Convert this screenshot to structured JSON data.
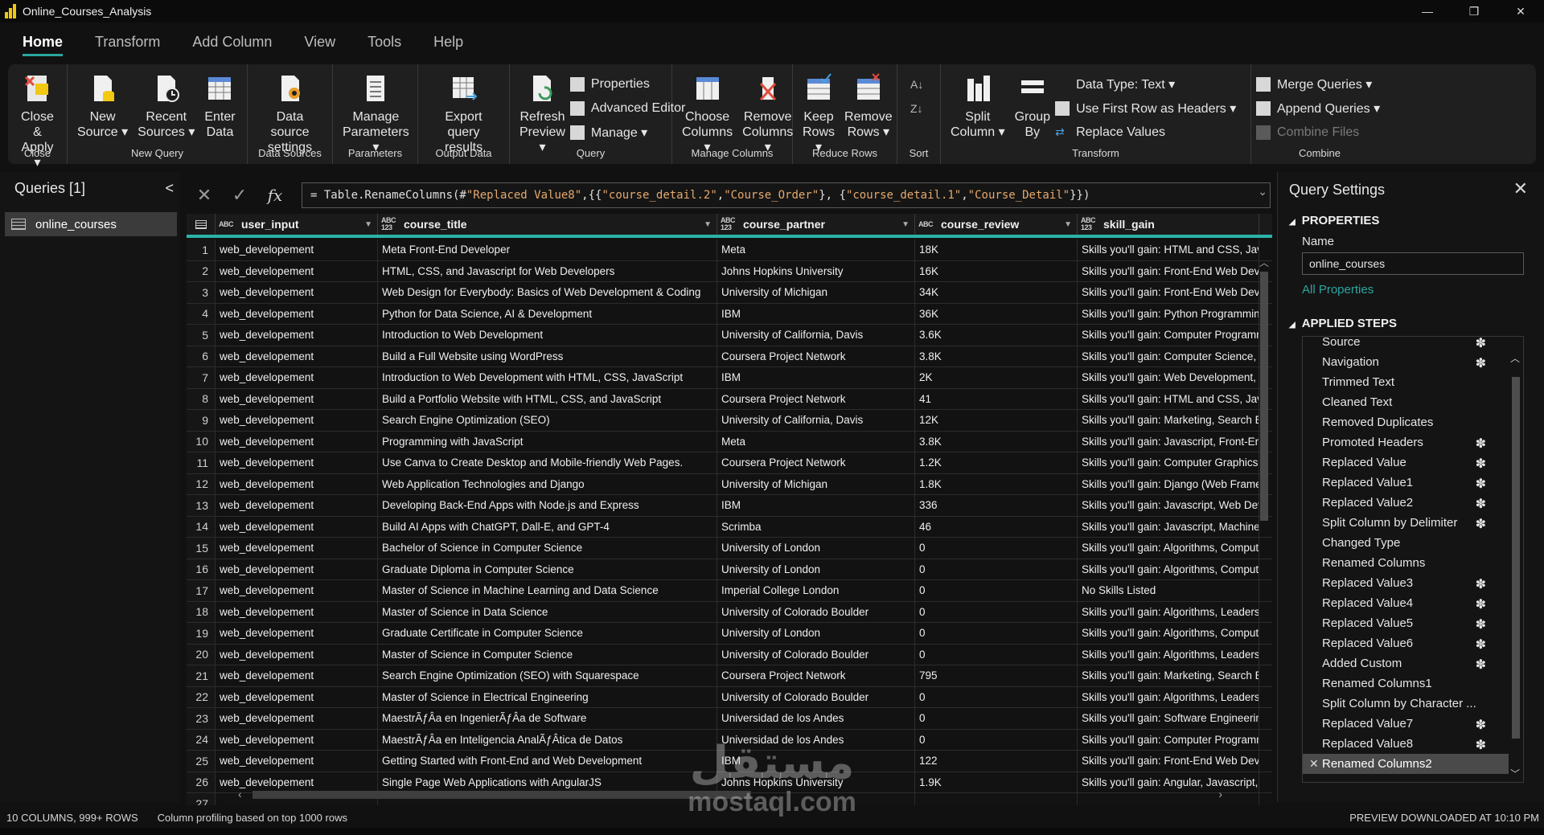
{
  "window": {
    "title": "Online_Courses_Analysis",
    "controls": [
      "—",
      "❐",
      "✕"
    ]
  },
  "menu": {
    "tabs": [
      "Home",
      "Transform",
      "Add Column",
      "View",
      "Tools",
      "Help"
    ],
    "active": "Home"
  },
  "ribbon": {
    "groups": {
      "close": {
        "label": "Close",
        "close_apply": "Close &\nApply ▾"
      },
      "new_query": {
        "label": "New Query",
        "new_source": "New\nSource ▾",
        "recent_sources": "Recent\nSources ▾",
        "enter_data": "Enter\nData"
      },
      "data_sources": {
        "label": "Data Sources",
        "settings": "Data source\nsettings"
      },
      "parameters": {
        "label": "Parameters",
        "manage": "Manage\nParameters ▾"
      },
      "output_data": {
        "label": "Output Data",
        "export": "Export query\nresults"
      },
      "query": {
        "label": "Query",
        "refresh": "Refresh\nPreview ▾",
        "properties": "Properties",
        "advanced_editor": "Advanced Editor",
        "manage": "Manage ▾"
      },
      "manage_columns": {
        "label": "Manage Columns",
        "choose": "Choose\nColumns ▾",
        "remove": "Remove\nColumns ▾"
      },
      "reduce_rows": {
        "label": "Reduce Rows",
        "keep": "Keep\nRows ▾",
        "remove": "Remove\nRows ▾"
      },
      "sort": {
        "label": "Sort"
      },
      "transform": {
        "label": "Transform",
        "split": "Split\nColumn ▾",
        "group": "Group\nBy",
        "data_type": "Data Type: Text ▾",
        "first_row": "Use First Row as Headers ▾",
        "replace": "Replace Values"
      },
      "combine": {
        "label": "Combine",
        "merge": "Merge Queries ▾",
        "append": "Append Queries ▾",
        "combine_files": "Combine Files"
      }
    }
  },
  "queries": {
    "title": "Queries [1]",
    "collapse": "<",
    "items": [
      "online_courses"
    ]
  },
  "formula": {
    "prefix": "= Table.RenameColumns(#",
    "s1": "\"Replaced Value8\"",
    "mid1": ",{{",
    "s2": "\"course_detail.2\"",
    "mid2": ", ",
    "s3": "\"Course_Order\"",
    "mid3": "}, {",
    "s4": "\"course_detail.1\"",
    "mid4": ", ",
    "s5": "\"Course_Detail\"",
    "suffix": "}})"
  },
  "grid": {
    "columns": [
      {
        "type": "ABC",
        "name": "user_input"
      },
      {
        "type": "ABC\n123",
        "name": "course_title"
      },
      {
        "type": "ABC\n123",
        "name": "course_partner"
      },
      {
        "type": "ABC",
        "name": "course_review"
      },
      {
        "type": "ABC\n123",
        "name": "skill_gain"
      }
    ],
    "rows": [
      [
        "1",
        "web_developement",
        "Meta Front-End Developer",
        "Meta",
        "18K",
        "Skills you'll gain: HTML and CSS, Javas"
      ],
      [
        "2",
        "web_developement",
        "HTML, CSS, and Javascript for Web Developers",
        "Johns Hopkins University",
        "16K",
        "Skills you'll gain: Front-End Web Deve"
      ],
      [
        "3",
        "web_developement",
        "Web Design for Everybody: Basics of Web Development & Coding",
        "University of Michigan",
        "34K",
        "Skills you'll gain: Front-End Web Deve"
      ],
      [
        "4",
        "web_developement",
        "Python for Data Science, AI & Development",
        "IBM",
        "36K",
        "Skills you'll gain: Python Programming"
      ],
      [
        "5",
        "web_developement",
        "Introduction to Web Development",
        "University of California, Davis",
        "3.6K",
        "Skills you'll gain: Computer Programm"
      ],
      [
        "6",
        "web_developement",
        "Build a Full Website using WordPress",
        "Coursera Project Network",
        "3.8K",
        "Skills you'll gain: Computer Science, Co"
      ],
      [
        "7",
        "web_developement",
        "Introduction to Web Development with HTML, CSS, JavaScript",
        "IBM",
        "2K",
        "Skills you'll gain: Web Development, Ja"
      ],
      [
        "8",
        "web_developement",
        "Build a Portfolio Website with HTML, CSS, and JavaScript",
        "Coursera Project Network",
        "41",
        "Skills you'll gain: HTML and CSS, Javas"
      ],
      [
        "9",
        "web_developement",
        "Search Engine Optimization (SEO)",
        "University of California, Davis",
        "12K",
        "Skills you'll gain: Marketing, Search En"
      ],
      [
        "10",
        "web_developement",
        "Programming with JavaScript",
        "Meta",
        "3.8K",
        "Skills you'll gain: Javascript, Front-End"
      ],
      [
        "11",
        "web_developement",
        "Use Canva to Create Desktop and Mobile-friendly Web Pages.",
        "Coursera Project Network",
        "1.2K",
        "Skills you'll gain: Computer Graphics, G"
      ],
      [
        "12",
        "web_developement",
        "Web Application Technologies and Django",
        "University of Michigan",
        "1.8K",
        "Skills you'll gain: Django (Web Framew"
      ],
      [
        "13",
        "web_developement",
        "Developing Back-End Apps with Node.js and Express",
        "IBM",
        "336",
        "Skills you'll gain: Javascript, Web Deve"
      ],
      [
        "14",
        "web_developement",
        "Build AI Apps with ChatGPT, Dall-E, and GPT-4",
        "Scrimba",
        "46",
        "Skills you'll gain: Javascript, Machine L"
      ],
      [
        "15",
        "web_developement",
        "Bachelor of Science in Computer Science",
        "University of London",
        "0",
        "Skills you'll gain: Algorithms, Comput"
      ],
      [
        "16",
        "web_developement",
        "Graduate Diploma in Computer Science",
        "University of London",
        "0",
        "Skills you'll gain: Algorithms, Comput"
      ],
      [
        "17",
        "web_developement",
        "Master of Science in Machine Learning and Data Science",
        "Imperial College London",
        "0",
        "No Skills Listed"
      ],
      [
        "18",
        "web_developement",
        "Master of Science in Data Science",
        "University of Colorado Boulder",
        "0",
        "Skills you'll gain: Algorithms, Leaders"
      ],
      [
        "19",
        "web_developement",
        "Graduate Certificate in Computer Science",
        "University of London",
        "0",
        "Skills you'll gain: Algorithms, Comput"
      ],
      [
        "20",
        "web_developement",
        "Master of Science in Computer Science",
        "University of Colorado Boulder",
        "0",
        "Skills you'll gain: Algorithms, Leaders"
      ],
      [
        "21",
        "web_developement",
        "Search Engine Optimization (SEO) with Squarespace",
        "Coursera Project Network",
        "795",
        "Skills you'll gain: Marketing, Search En"
      ],
      [
        "22",
        "web_developement",
        "Master of Science in Electrical Engineering",
        "University of Colorado Boulder",
        "0",
        "Skills you'll gain: Algorithms, Leaders"
      ],
      [
        "23",
        "web_developement",
        "MaestrÃƒÂa en IngenierÃƒÂa de Software",
        "Universidad de los Andes",
        "0",
        "Skills you'll gain: Software Engineerin"
      ],
      [
        "24",
        "web_developement",
        "MaestrÃƒÂa en Inteligencia AnalÃƒÂtica de Datos",
        "Universidad de los Andes",
        "0",
        "Skills you'll gain: Computer Programm"
      ],
      [
        "25",
        "web_developement",
        "Getting Started with Front-End and Web Development",
        "IBM",
        "122",
        "Skills you'll gain: Front-End Web Deve"
      ],
      [
        "26",
        "web_developement",
        "Single Page Web Applications with AngularJS",
        "Johns Hopkins University",
        "1.9K",
        "Skills you'll gain: Angular, Javascript,"
      ],
      [
        "27",
        "",
        "",
        "",
        "",
        ""
      ]
    ]
  },
  "settings": {
    "title": "Query Settings",
    "properties_heading": "PROPERTIES",
    "name_label": "Name",
    "name_value": "online_courses",
    "all_properties": "All Properties",
    "steps_heading": "APPLIED STEPS",
    "steps": [
      {
        "name": "Source",
        "gear": true
      },
      {
        "name": "Navigation",
        "gear": true
      },
      {
        "name": "Trimmed Text",
        "gear": false
      },
      {
        "name": "Cleaned Text",
        "gear": false
      },
      {
        "name": "Removed Duplicates",
        "gear": false
      },
      {
        "name": "Promoted Headers",
        "gear": true
      },
      {
        "name": "Replaced Value",
        "gear": true
      },
      {
        "name": "Replaced Value1",
        "gear": true
      },
      {
        "name": "Replaced Value2",
        "gear": true
      },
      {
        "name": "Split Column by Delimiter",
        "gear": true
      },
      {
        "name": "Changed Type",
        "gear": false
      },
      {
        "name": "Renamed Columns",
        "gear": false
      },
      {
        "name": "Replaced Value3",
        "gear": true
      },
      {
        "name": "Replaced Value4",
        "gear": true
      },
      {
        "name": "Replaced Value5",
        "gear": true
      },
      {
        "name": "Replaced Value6",
        "gear": true
      },
      {
        "name": "Added Custom",
        "gear": true
      },
      {
        "name": "Renamed Columns1",
        "gear": false
      },
      {
        "name": "Split Column by Character ...",
        "gear": false
      },
      {
        "name": "Replaced Value7",
        "gear": true
      },
      {
        "name": "Replaced Value8",
        "gear": true
      },
      {
        "name": "Renamed Columns2",
        "gear": false,
        "selected": true
      }
    ]
  },
  "status": {
    "columns_rows": "10 COLUMNS, 999+ ROWS",
    "profiling": "Column profiling based on top 1000 rows",
    "preview": "PREVIEW DOWNLOADED AT 10:10 PM"
  },
  "watermark": {
    "arabic": "مستقل",
    "url": "mostaql.com"
  },
  "colors": {
    "accent": "#2aa6a0",
    "header_underline": "#2bb3a8",
    "formula_string": "#e5a96d",
    "pbi_yellow": "#f2c811"
  }
}
